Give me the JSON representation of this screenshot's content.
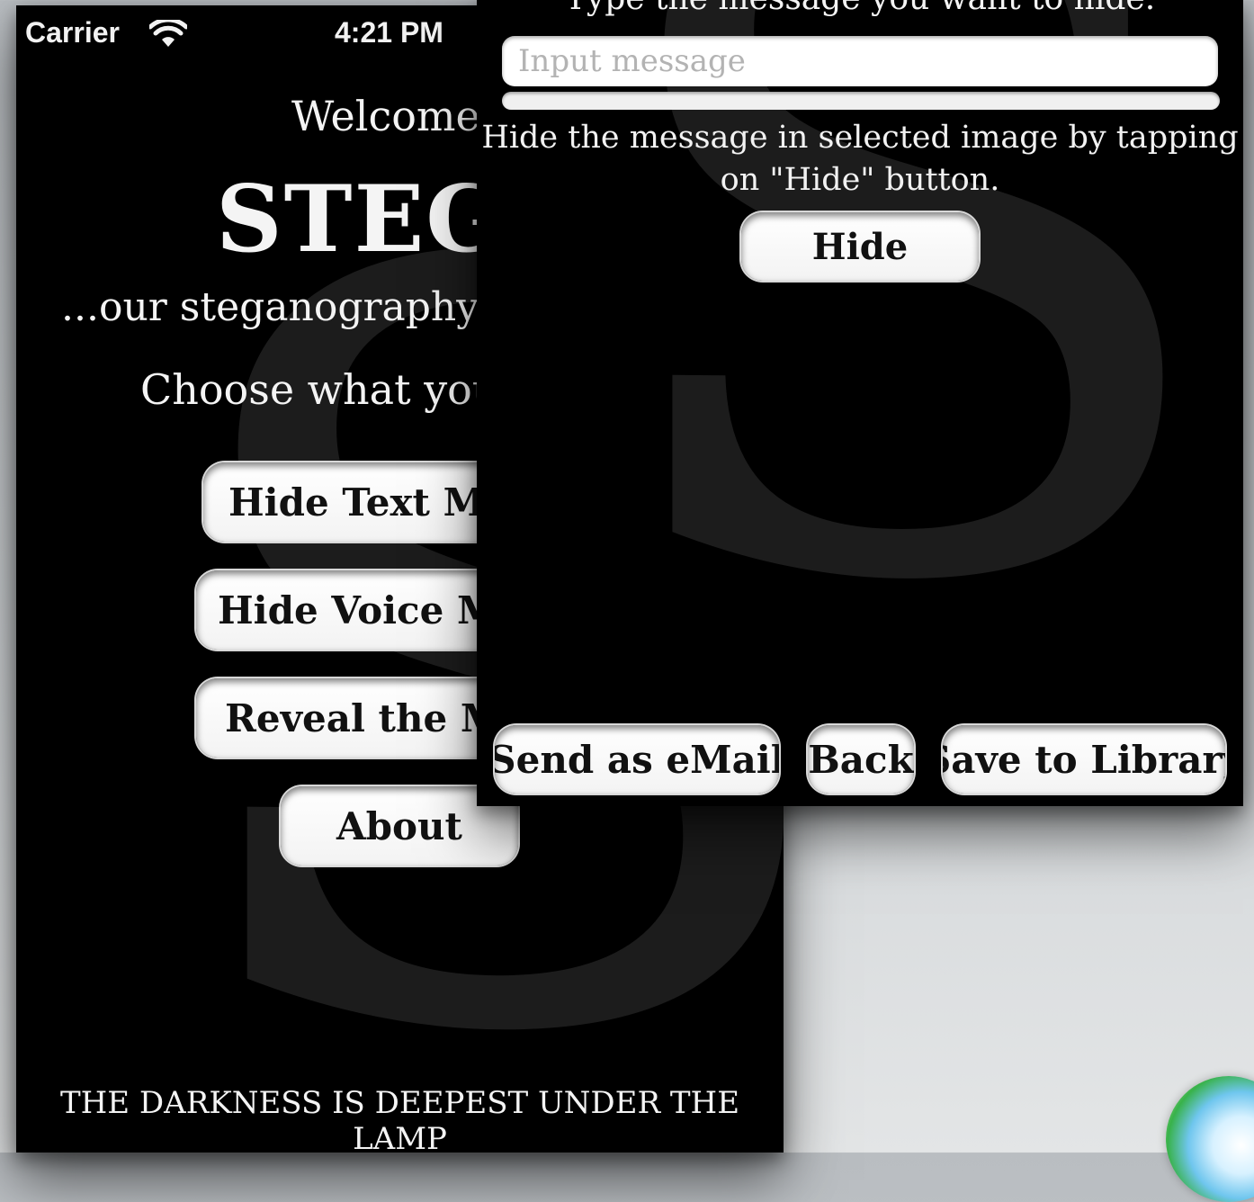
{
  "status_bar": {
    "carrier": "Carrier",
    "time": "4:21 PM",
    "wifi_icon": "wifi-icon"
  },
  "home_screen": {
    "watermark": "S",
    "welcome": "Welcome t",
    "title": "STEGA",
    "tagline": "...our steganography sof",
    "prompt": "Choose what you w",
    "buttons": {
      "hide_text": "Hide Text Mes",
      "hide_voice": "Hide Voice Me",
      "reveal": "Reveal the Me",
      "about": "About"
    },
    "motto": "THE DARKNESS IS DEEPEST UNDER THE LAMP"
  },
  "hide_screen": {
    "watermark": "S",
    "instruction_top": "Type the message you want to hide.",
    "input": {
      "placeholder": "Input message",
      "value": ""
    },
    "progress": 0,
    "instruction_hide": "Hide the message in selected image by tapping on \"Hide\" button.",
    "buttons": {
      "hide": "Hide",
      "send_email": "Send as eMail",
      "back": "Back",
      "save_library": "Save to Library"
    }
  },
  "colors": {
    "screen_bg": "#000000",
    "button_bg": "#ffffff",
    "text": "#f4f4f4",
    "watermark": "#1c1c1c"
  }
}
